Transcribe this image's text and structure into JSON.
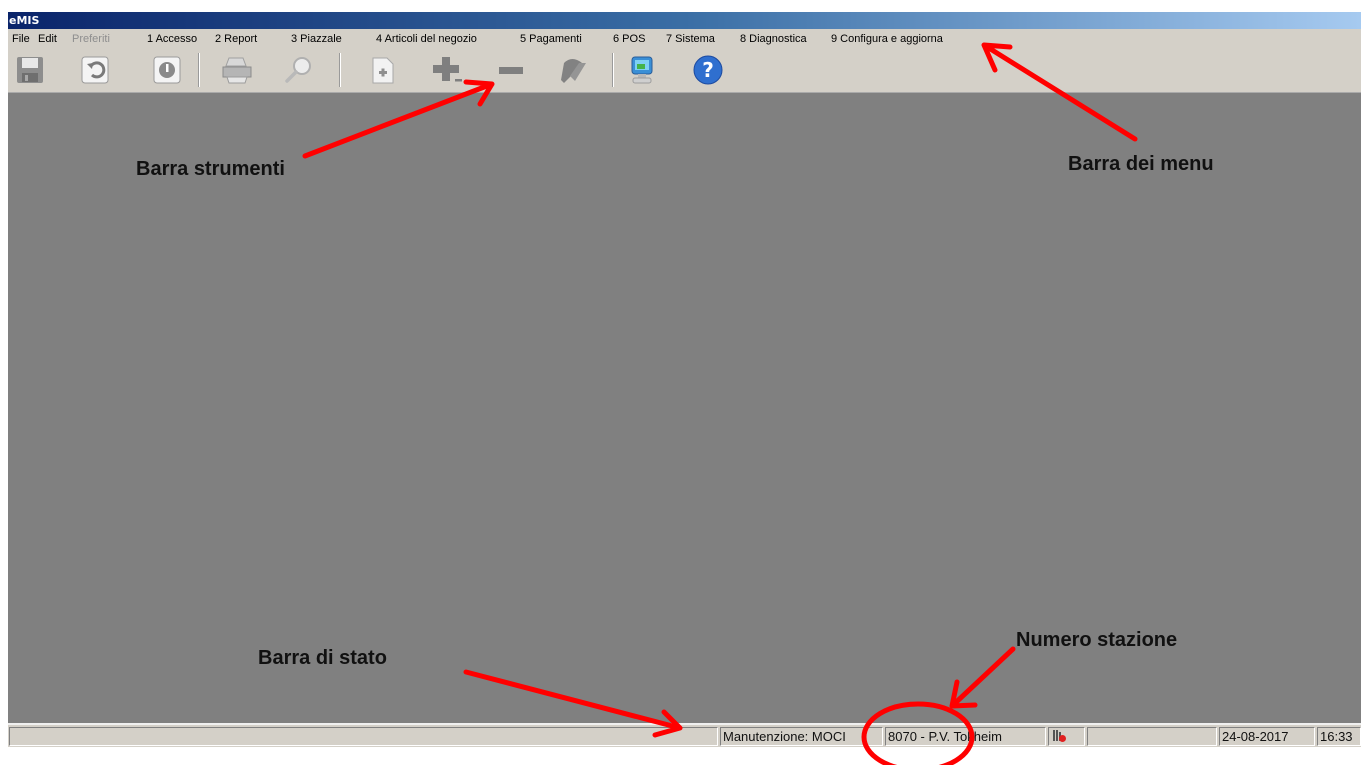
{
  "window": {
    "title": "eMIS"
  },
  "menubar": {
    "items": [
      {
        "label": "File",
        "enabled": true
      },
      {
        "label": "Edit",
        "enabled": true
      },
      {
        "label": "Preferiti",
        "enabled": false
      },
      {
        "label": "1 Accesso",
        "enabled": true
      },
      {
        "label": "2 Report",
        "enabled": true
      },
      {
        "label": "3 Piazzale",
        "enabled": true
      },
      {
        "label": "4 Articoli del negozio",
        "enabled": true
      },
      {
        "label": "5 Pagamenti",
        "enabled": true
      },
      {
        "label": "6 POS",
        "enabled": true
      },
      {
        "label": "7 Sistema",
        "enabled": true
      },
      {
        "label": "8 Diagnostica",
        "enabled": true
      },
      {
        "label": "9 Configura e aggiorna",
        "enabled": true
      }
    ]
  },
  "toolbar": {
    "buttons": [
      "save-icon",
      "undo-icon",
      "power-icon",
      "print-icon",
      "search-icon",
      "new-document-icon",
      "add-icon",
      "remove-icon",
      "delete-icon",
      "monitor-icon",
      "help-icon"
    ]
  },
  "statusbar": {
    "panels": [
      "",
      "Manutenzione: MOCI",
      "8070 - P.V. Tokheim",
      "",
      "",
      "24-08-2017",
      "16:33"
    ]
  },
  "annotations": {
    "toolbar_label": "Barra strumenti",
    "menubar_label": "Barra dei menu",
    "statusbar_label": "Barra di stato",
    "station_label": "Numero stazione",
    "color": "#ff0000"
  }
}
